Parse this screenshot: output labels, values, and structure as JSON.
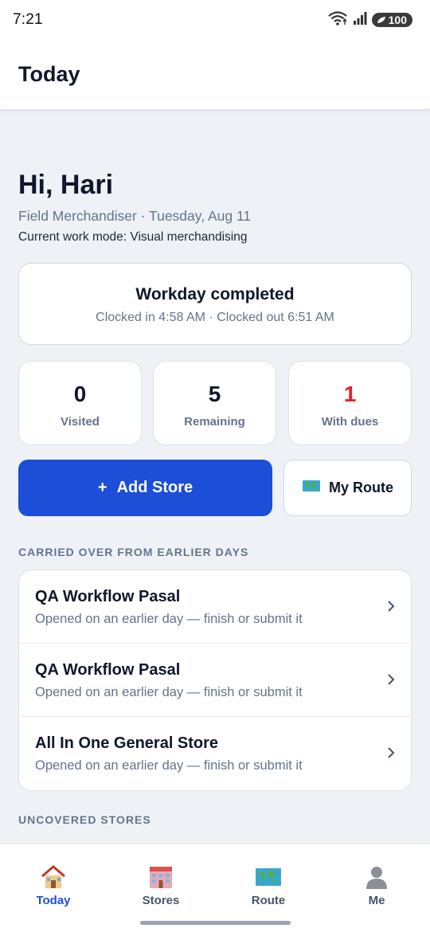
{
  "status": {
    "time": "7:21",
    "battery": "100"
  },
  "header": {
    "title": "Today"
  },
  "greeting": {
    "hello": "Hi, Hari",
    "subline": "Field Merchandiser · Tuesday, Aug 11",
    "mode": "Current work mode: Visual merchandising"
  },
  "workday": {
    "title": "Workday completed",
    "times": "Clocked in 4:58 AM · Clocked out 6:51 AM"
  },
  "stats": [
    {
      "value": "0",
      "label": "Visited"
    },
    {
      "value": "5",
      "label": "Remaining"
    },
    {
      "value": "1",
      "label": "With dues"
    }
  ],
  "actions": {
    "add_store": "Add Store",
    "add_symbol": "+",
    "my_route": "My Route"
  },
  "carried_over": {
    "label": "CARRIED OVER FROM EARLIER DAYS",
    "items": [
      {
        "title": "QA Workflow Pasal",
        "subtitle": "Opened on an earlier day — finish or submit it"
      },
      {
        "title": "QA Workflow Pasal",
        "subtitle": "Opened on an earlier day — finish or submit it"
      },
      {
        "title": "All In One General Store",
        "subtitle": "Opened on an earlier day — finish or submit it"
      }
    ]
  },
  "uncovered": {
    "label": "UNCOVERED STORES"
  },
  "nav": [
    {
      "label": "Today",
      "icon": "house-icon",
      "active": true
    },
    {
      "label": "Stores",
      "icon": "building-icon"
    },
    {
      "label": "Route",
      "icon": "map-icon"
    },
    {
      "label": "Me",
      "icon": "person-icon"
    }
  ],
  "colors": {
    "primary": "#1d4ed8",
    "dues": "#dc2626",
    "background": "#eef2f7"
  }
}
